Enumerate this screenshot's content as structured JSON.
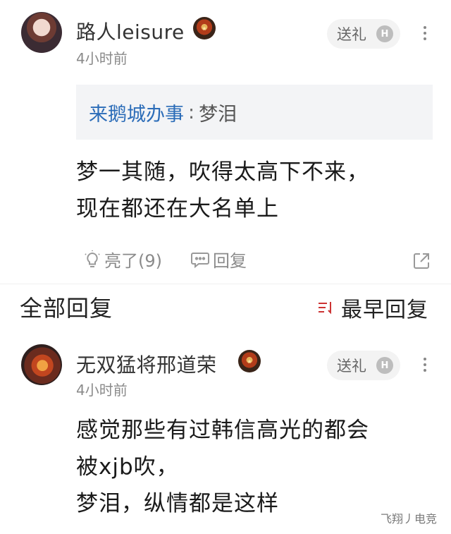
{
  "main_comment": {
    "username": "路人leisure",
    "time": "4小时前",
    "gift_label": "送礼",
    "quote": {
      "user": "来鹅城办事",
      "separator": ":",
      "text": "梦泪"
    },
    "text_lines": [
      "梦一其随，吹得太高下不来，",
      "现在都还在大名单上"
    ],
    "like_label": "亮了(9)",
    "reply_label": "回复"
  },
  "replies_header": {
    "title": "全部回复",
    "sort_label": "最早回复"
  },
  "reply": {
    "username": "无双猛将邢道荣",
    "time": "4小时前",
    "gift_label": "送礼",
    "text_lines": [
      "感觉那些有过韩信高光的都会",
      "被xjb吹，",
      "梦泪，纵情都是这样"
    ]
  },
  "watermark": "飞翔丿电竞",
  "colors": {
    "quote_user": "#2b6cb8",
    "secondary_text": "#8a8a8a",
    "gift_bg": "#f3f3f3"
  }
}
